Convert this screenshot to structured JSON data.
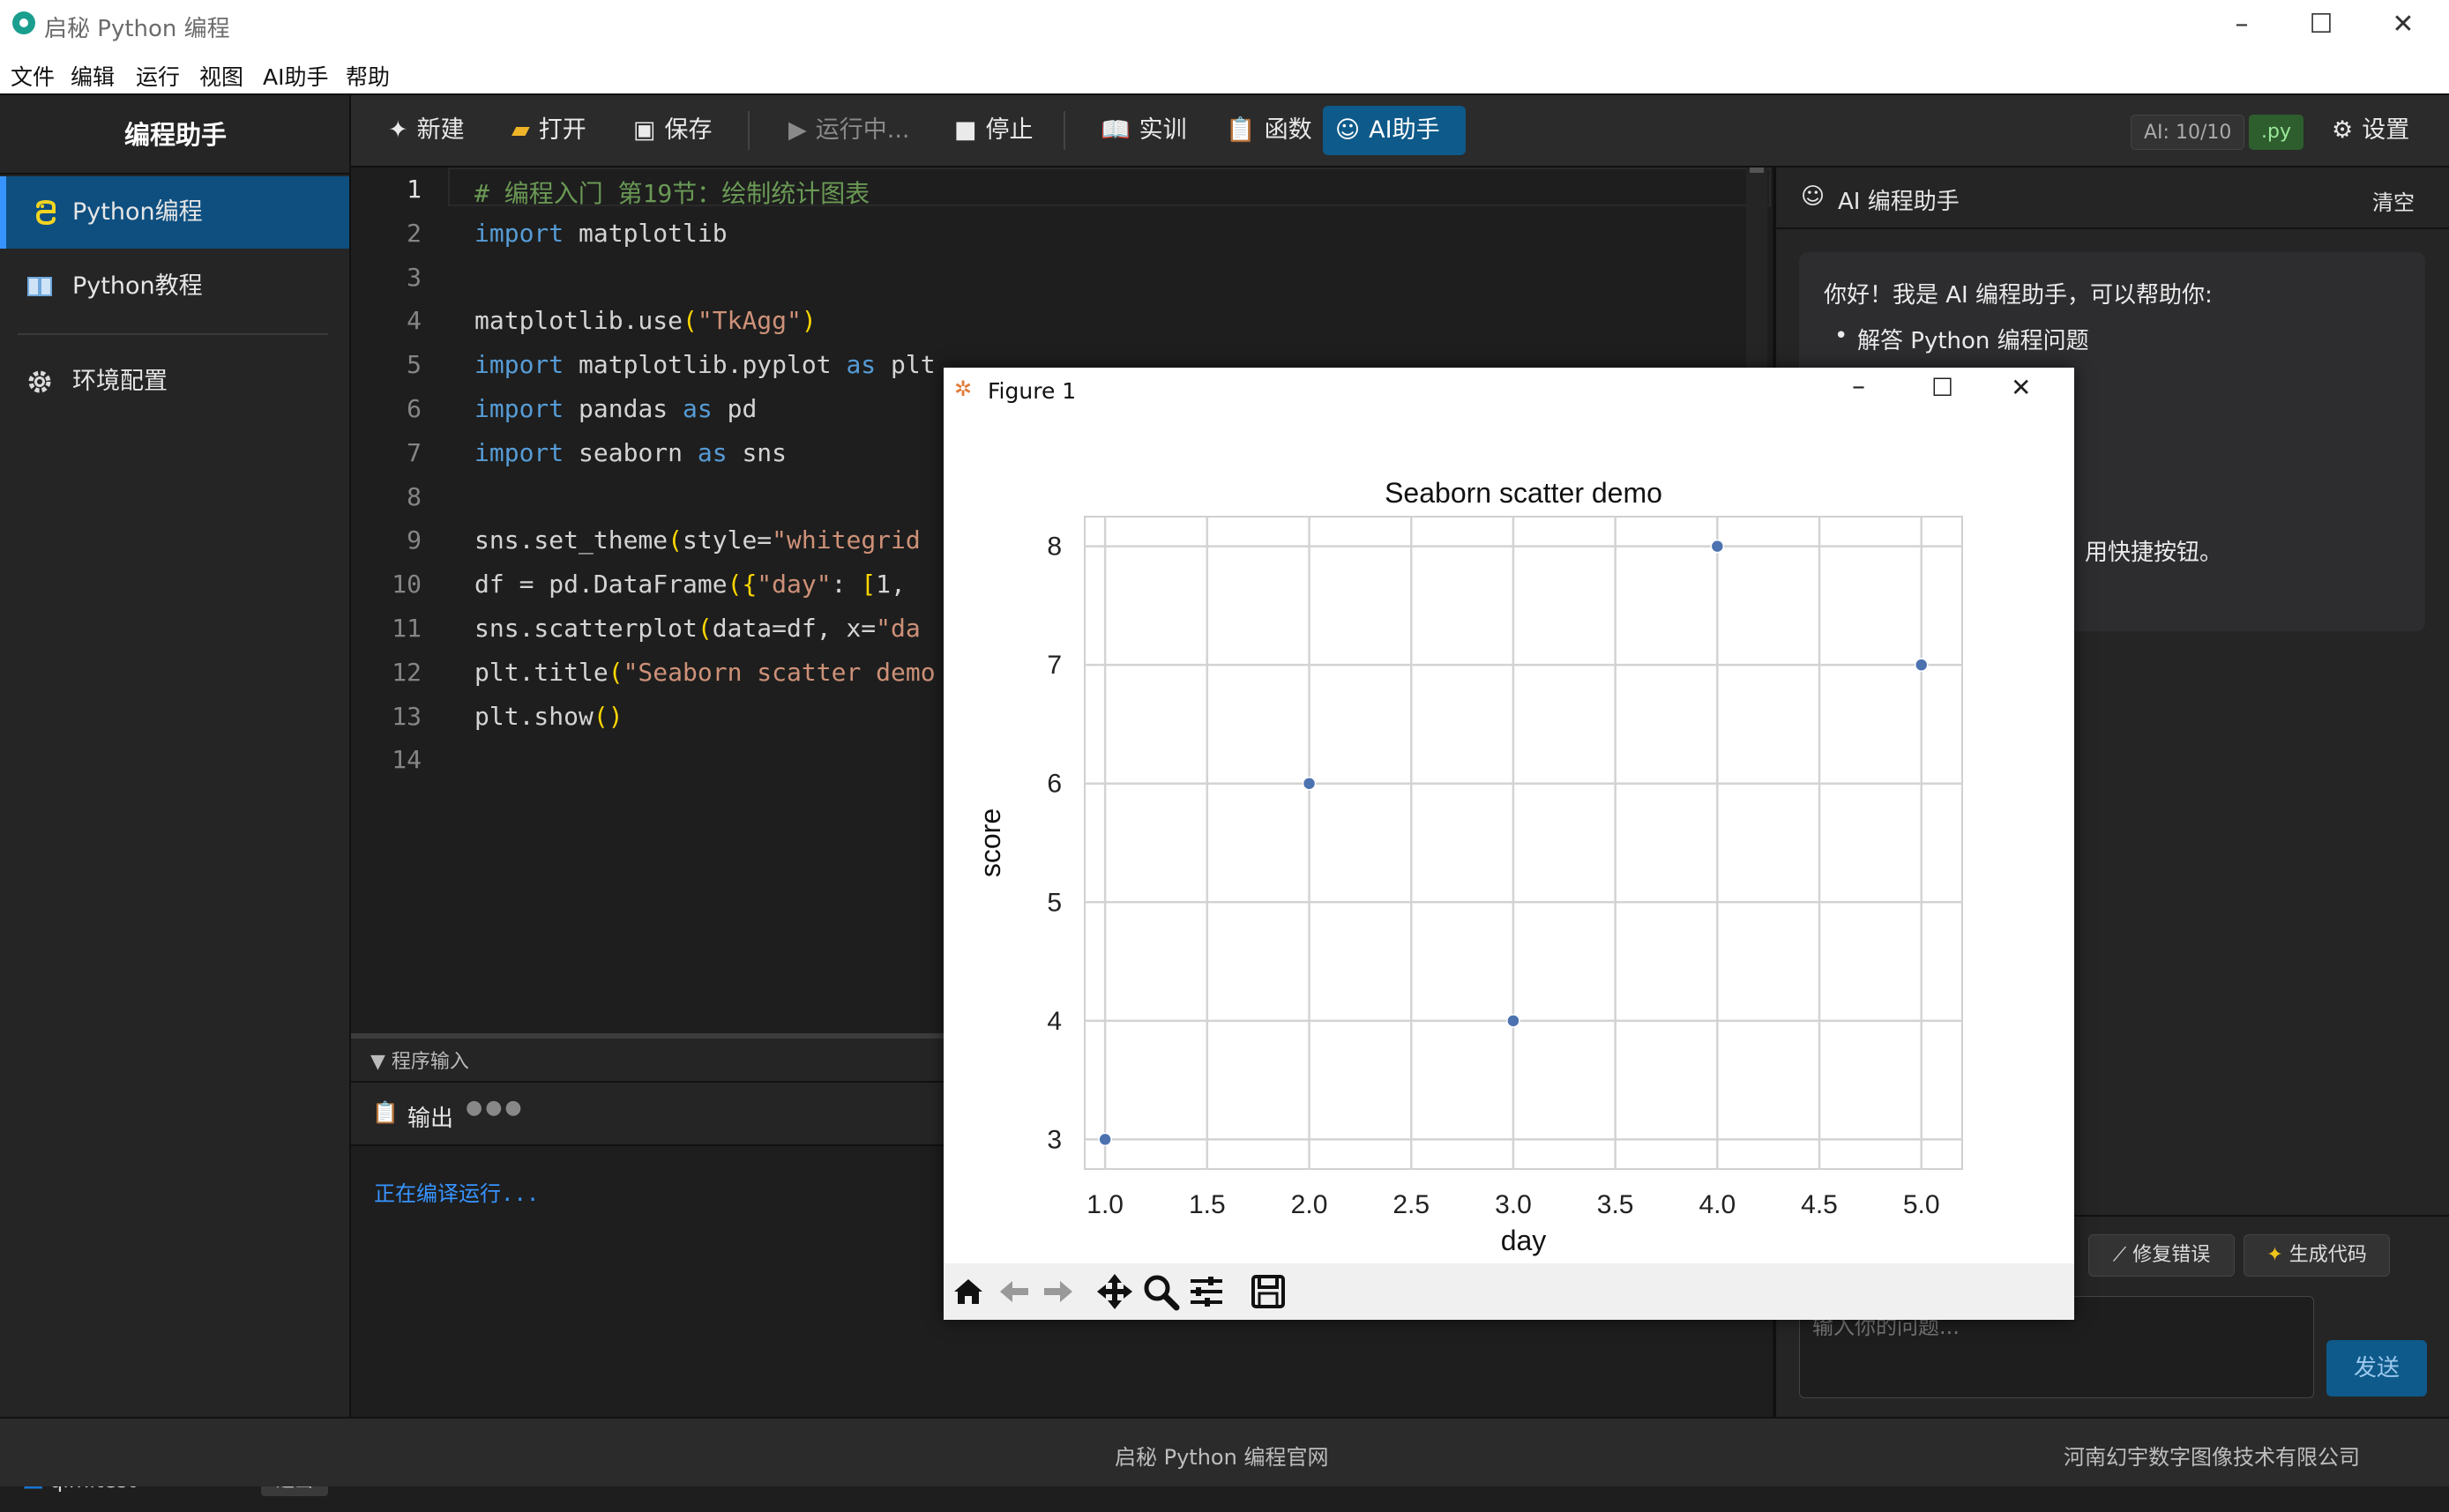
{
  "window": {
    "title": "启秘 Python 编程"
  },
  "menu": [
    "文件",
    "编辑",
    "运行",
    "视图",
    "AI助手",
    "帮助"
  ],
  "sidebar": {
    "header": "编程助手",
    "items": [
      {
        "label": "Python编程",
        "icon": "python-icon",
        "active": true
      },
      {
        "label": "Python教程",
        "icon": "book-icon",
        "active": false
      },
      {
        "label": "环境配置",
        "icon": "gear-icon",
        "active": false
      }
    ],
    "user": {
      "name": "qimitest",
      "logout": "退出"
    }
  },
  "toolbar": {
    "new": "新建",
    "open": "打开",
    "save": "保存",
    "running": "运行中...",
    "stop": "停止",
    "practice": "实训",
    "functions": "函数",
    "ai": "AI助手",
    "ai_quota": "AI: 10/10",
    "file_ext": ".py",
    "settings": "设置"
  },
  "editor": {
    "lines": [
      "# 编程入门 第19节：绘制统计图表",
      "import matplotlib",
      "",
      "matplotlib.use(\"TkAgg\")",
      "import matplotlib.pyplot as plt",
      "import pandas as pd",
      "import seaborn as sns",
      "",
      "sns.set_theme(style=\"whitegrid",
      "df = pd.DataFrame({\"day\": [1, ",
      "sns.scatterplot(data=df, x=\"da",
      "plt.title(\"Seaborn scatter demo",
      "plt.show()",
      ""
    ],
    "current_line": 1
  },
  "input_panel": {
    "label": "▼ 程序输入"
  },
  "output_panel": {
    "label": "输出",
    "text": "正在编译运行..."
  },
  "ai_panel": {
    "title": "AI 编程助手",
    "clear": "清空",
    "greeting": "你好！我是 AI 编程助手，可以帮助你:",
    "bullets": [
      "解答 Python 编程问题"
    ],
    "tail": "用快捷按钮。",
    "fix_button": "修复错误",
    "gen_button": "生成代码",
    "input_placeholder": "输入你的问题...",
    "send": "发送"
  },
  "footer": {
    "center": "启秘 Python 编程官网",
    "right": "河南幻宇数字图像技术有限公司"
  },
  "figure": {
    "title": "Figure 1"
  },
  "chart_data": {
    "type": "scatter",
    "title": "Seaborn scatter demo",
    "xlabel": "day",
    "ylabel": "score",
    "x": [
      1,
      2,
      3,
      4,
      5
    ],
    "y": [
      3,
      6,
      4,
      8,
      7
    ],
    "xlim": [
      0.9,
      5.2
    ],
    "ylim": [
      2.75,
      8.25
    ],
    "xticks": [
      "1.0",
      "1.5",
      "2.0",
      "2.5",
      "3.0",
      "3.5",
      "4.0",
      "4.5",
      "5.0"
    ],
    "yticks": [
      "3",
      "4",
      "5",
      "6",
      "7",
      "8"
    ],
    "grid": true,
    "color": "#4c72b0"
  },
  "colors": {
    "accent": "#0e5a8a",
    "active_nav": "#0e4f80",
    "link": "#3794ff"
  }
}
